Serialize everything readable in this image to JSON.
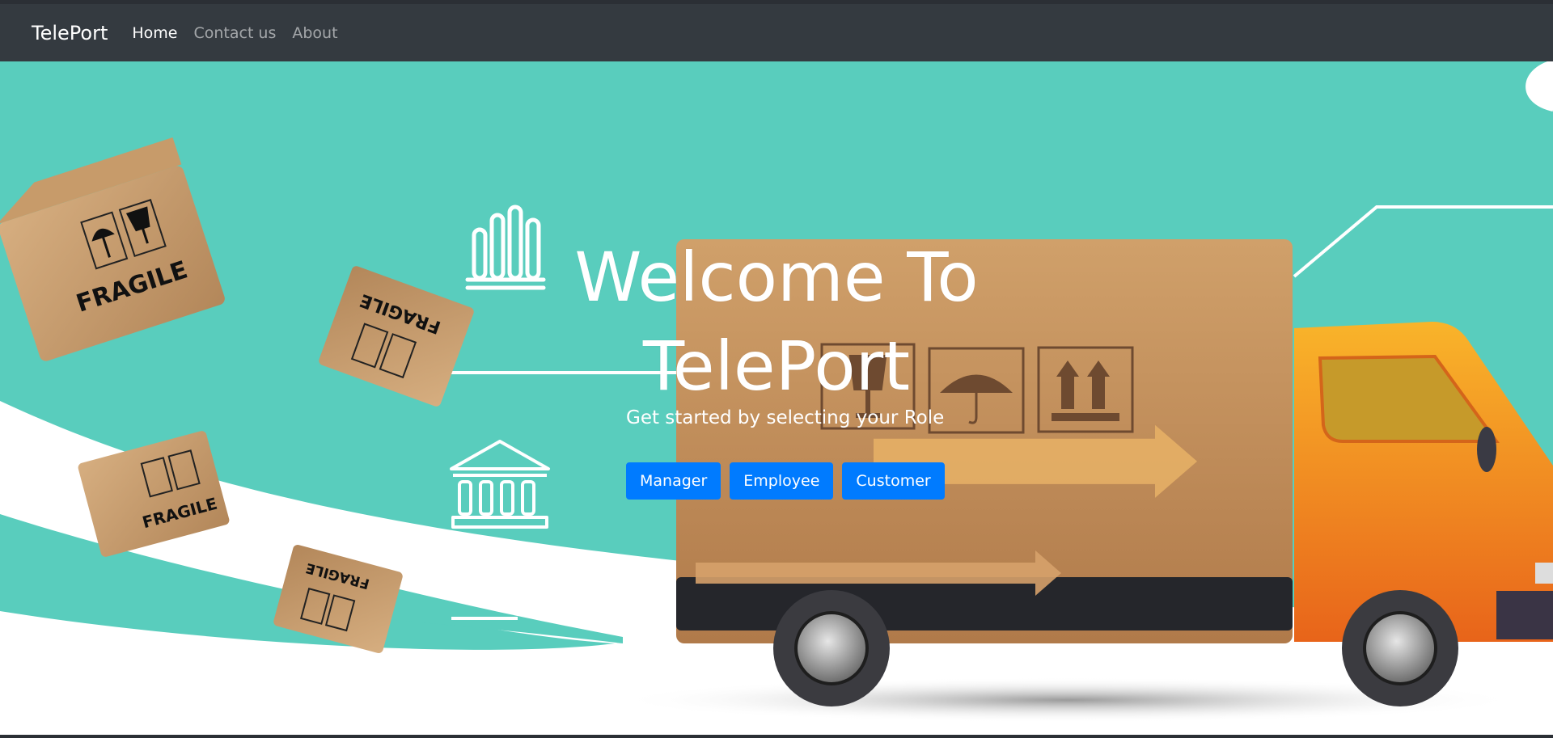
{
  "navbar": {
    "brand": "TelePort",
    "links": [
      {
        "label": "Home",
        "active": true
      },
      {
        "label": "Contact us",
        "active": false
      },
      {
        "label": "About",
        "active": false
      }
    ]
  },
  "hero": {
    "title_line1": "Welcome To",
    "title_line2": "TelePort",
    "subtitle": "Get started by selecting your Role",
    "buttons": [
      "Manager",
      "Employee",
      "Customer"
    ],
    "box_label": "FRAGILE",
    "colors": {
      "background": "#59cdbd",
      "button": "#007bff",
      "navbar": "#343a40",
      "truck_cab": "#f7941d"
    },
    "icons": [
      "bar-chart-icon",
      "bank-icon",
      "umbrella-icon",
      "fragile-glass-icon",
      "this-way-up-icon",
      "arrow-icon"
    ]
  }
}
